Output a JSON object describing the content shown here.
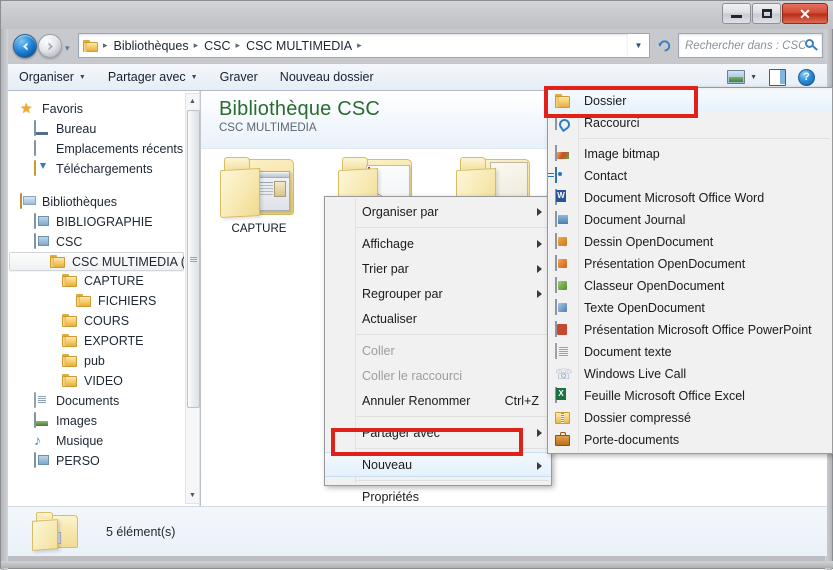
{
  "window": {
    "buttons": {
      "minimize": "—",
      "maximize": "□",
      "close": "✕"
    }
  },
  "navbar": {
    "back_icon": "back-arrow-icon",
    "forward_icon": "forward-arrow-icon",
    "history_caret": "▾",
    "breadcrumbs": [
      "Bibliothèques",
      "CSC",
      "CSC MULTIMEDIA"
    ],
    "breadcrumb_sep": "▸",
    "dropdown_caret": "▼",
    "refresh_glyph": "↻"
  },
  "search": {
    "placeholder": "Rechercher dans : CSC MUL...",
    "icon": "search-icon"
  },
  "toolbar": {
    "organiser": "Organiser",
    "partager": "Partager avec",
    "graver": "Graver",
    "nouveau_dossier": "Nouveau dossier",
    "caret": "▼",
    "help_glyph": "?"
  },
  "sidebar": {
    "groups": [
      {
        "header": {
          "label": "Favoris",
          "icon": "star-icon"
        },
        "items": [
          {
            "label": "Bureau",
            "icon": "desktop-icon",
            "indent": 1
          },
          {
            "label": "Emplacements récents",
            "icon": "recent-places-icon",
            "indent": 1
          },
          {
            "label": "Téléchargements",
            "icon": "downloads-icon",
            "indent": 1
          }
        ]
      },
      {
        "header": {
          "label": "Bibliothèques",
          "icon": "libraries-icon"
        },
        "items": [
          {
            "label": "BIBLIOGRAPHIE",
            "icon": "library-icon",
            "indent": 1
          },
          {
            "label": "CSC",
            "icon": "library-icon",
            "indent": 1
          },
          {
            "label": "CSC MULTIMEDIA (C:)",
            "icon": "folder-icon",
            "indent": 2,
            "selected": true
          },
          {
            "label": "CAPTURE",
            "icon": "folder-icon",
            "indent": 3
          },
          {
            "label": "FICHIERS",
            "icon": "folder-icon",
            "indent": 4
          },
          {
            "label": "COURS",
            "icon": "folder-icon",
            "indent": 3
          },
          {
            "label": "EXPORTE",
            "icon": "folder-icon",
            "indent": 3
          },
          {
            "label": "pub",
            "icon": "folder-icon",
            "indent": 3
          },
          {
            "label": "VIDEO",
            "icon": "folder-icon",
            "indent": 3
          },
          {
            "label": "Documents",
            "icon": "documents-icon",
            "indent": 1
          },
          {
            "label": "Images",
            "icon": "pictures-icon",
            "indent": 1
          },
          {
            "label": "Musique",
            "icon": "music-icon",
            "indent": 1
          },
          {
            "label": "PERSO",
            "icon": "library-icon",
            "indent": 1
          }
        ]
      }
    ],
    "scroll_up": "▲",
    "scroll_down": "▼"
  },
  "content": {
    "library_title": "Bibliothèque CSC",
    "library_subtitle": "CSC MULTIMEDIA",
    "items": [
      {
        "label": "CAPTURE",
        "icon": "folder-capture-icon"
      },
      {
        "label": "",
        "icon": "folder-icon"
      },
      {
        "label": "",
        "icon": "folder-icon"
      }
    ]
  },
  "context_menu": {
    "items": [
      {
        "label": "Organiser par",
        "submenu": true
      },
      {
        "separator": true
      },
      {
        "label": "Affichage",
        "submenu": true
      },
      {
        "label": "Trier par",
        "submenu": true
      },
      {
        "label": "Regrouper par",
        "submenu": true
      },
      {
        "label": "Actualiser",
        "submenu": false
      },
      {
        "separator": true
      },
      {
        "label": "Coller",
        "disabled": true
      },
      {
        "label": "Coller le raccourci",
        "disabled": true
      },
      {
        "label": "Annuler Renommer",
        "accel": "Ctrl+Z"
      },
      {
        "separator": true
      },
      {
        "label": "Partager avec",
        "submenu": true
      },
      {
        "separator": true
      },
      {
        "label": "Nouveau",
        "submenu": true,
        "highlighted": true
      },
      {
        "separator": true
      },
      {
        "label": "Propriétés"
      }
    ]
  },
  "new_submenu": {
    "items": [
      {
        "label": "Dossier",
        "icon": "folder-icon",
        "highlighted": true
      },
      {
        "label": "Raccourci",
        "icon": "shortcut-icon"
      },
      {
        "separator": true
      },
      {
        "label": "Image bitmap",
        "icon": "bitmap-image-icon"
      },
      {
        "label": "Contact",
        "icon": "contact-icon"
      },
      {
        "label": "Document Microsoft Office Word",
        "icon": "word-document-icon"
      },
      {
        "label": "Document Journal",
        "icon": "journal-document-icon"
      },
      {
        "label": "Dessin OpenDocument",
        "icon": "opendocument-drawing-icon"
      },
      {
        "label": "Présentation OpenDocument",
        "icon": "opendocument-presentation-icon"
      },
      {
        "label": "Classeur OpenDocument",
        "icon": "opendocument-spreadsheet-icon"
      },
      {
        "label": "Texte OpenDocument",
        "icon": "opendocument-text-icon"
      },
      {
        "label": "Présentation Microsoft Office PowerPoint",
        "icon": "powerpoint-document-icon"
      },
      {
        "label": "Document texte",
        "icon": "text-document-icon"
      },
      {
        "label": "Windows Live Call",
        "icon": "windows-live-call-icon"
      },
      {
        "label": "Feuille Microsoft Office Excel",
        "icon": "excel-sheet-icon"
      },
      {
        "label": "Dossier compressé",
        "icon": "compressed-folder-icon"
      },
      {
        "label": "Porte-documents",
        "icon": "briefcase-icon"
      }
    ]
  },
  "statusbar": {
    "item_count": "5 élément(s)",
    "icon": "folder-icon"
  },
  "colors": {
    "annotation_red": "#e0211a",
    "library_title_green": "#2b6b2e",
    "highlight_blue": "#e3f0fb"
  }
}
